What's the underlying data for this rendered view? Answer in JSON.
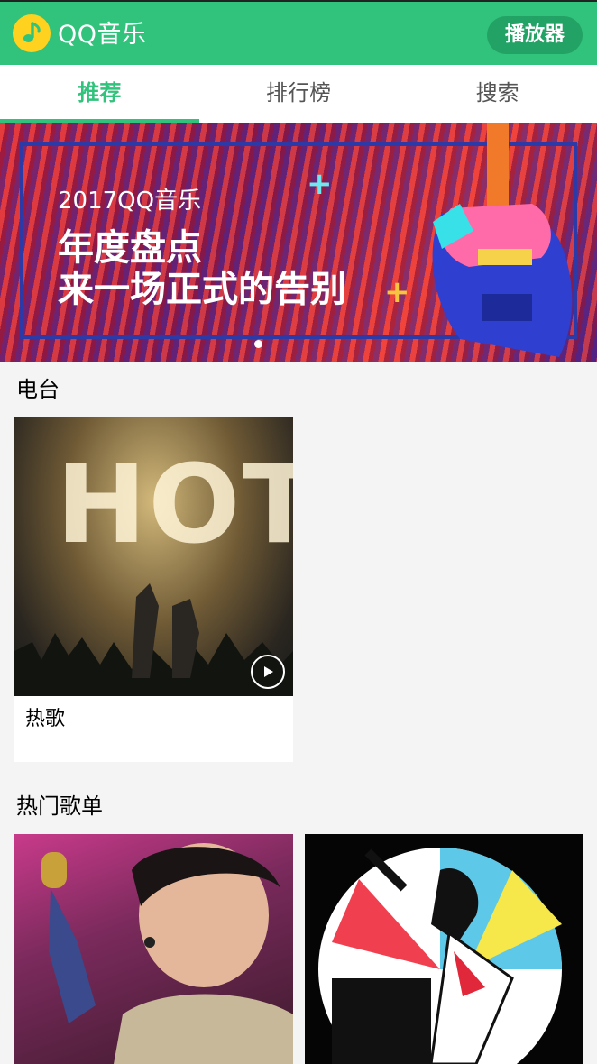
{
  "header": {
    "brand": "QQ音乐",
    "player_button": "播放器"
  },
  "tabs": [
    {
      "label": "推荐",
      "active": true
    },
    {
      "label": "排行榜",
      "active": false
    },
    {
      "label": "搜索",
      "active": false
    }
  ],
  "banner": {
    "subtitle": "2017QQ音乐",
    "line1": "年度盘点",
    "line2": "来一场正式的告别"
  },
  "sections": {
    "radio_title": "电台",
    "radio_items": [
      {
        "label": "热歌",
        "cover_text": "HOT"
      }
    ],
    "playlist_title": "热门歌单"
  },
  "colors": {
    "brand_green": "#31c27c",
    "player_button": "#23a265"
  }
}
